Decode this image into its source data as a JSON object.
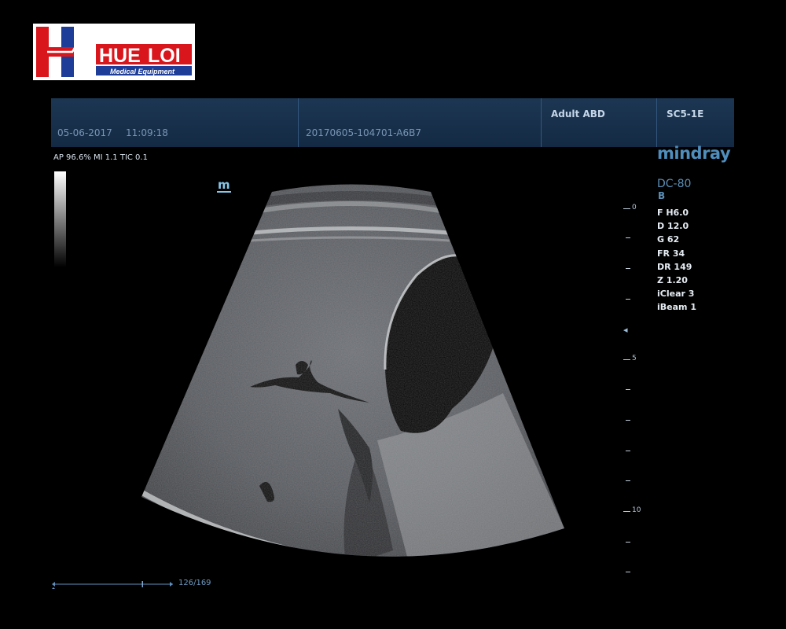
{
  "logo": {
    "text_part1": "HUE",
    "text_part2": "LOI",
    "subtitle": "Medical Equipment",
    "colors": {
      "red": "#d8161c",
      "blue": "#1d3d98",
      "white": "#ffffff"
    }
  },
  "header": {
    "date": "05-06-2017",
    "time": "11:09:18",
    "exam_id": "20170605-104701-A6B7",
    "exam_type": "Adult ABD",
    "probe": "SC5-1E"
  },
  "acoustic_output": "AP 96.6%  MI 1.1  TIC 0.1",
  "orientation_marker": "m",
  "device": {
    "brand": "mindray",
    "model": "DC-80",
    "mode": "B"
  },
  "imaging_params": [
    "F H6.0",
    "D 12.0",
    "G 62",
    "FR 34",
    "DR 149",
    "Z 1.20",
    "iClear 3",
    "iBeam 1"
  ],
  "depth_scale": {
    "labels": [
      "0",
      "5",
      "10"
    ],
    "unit_max_cm": 12,
    "focus_marker": "4"
  },
  "cine": {
    "frame_counter": "126/169",
    "current_fraction": 0.745
  },
  "colors": {
    "header_bg": "#1a3350",
    "header_text": "#7896b4",
    "accent_blue": "#4f8dbd",
    "param_text": "#e6edf4"
  }
}
